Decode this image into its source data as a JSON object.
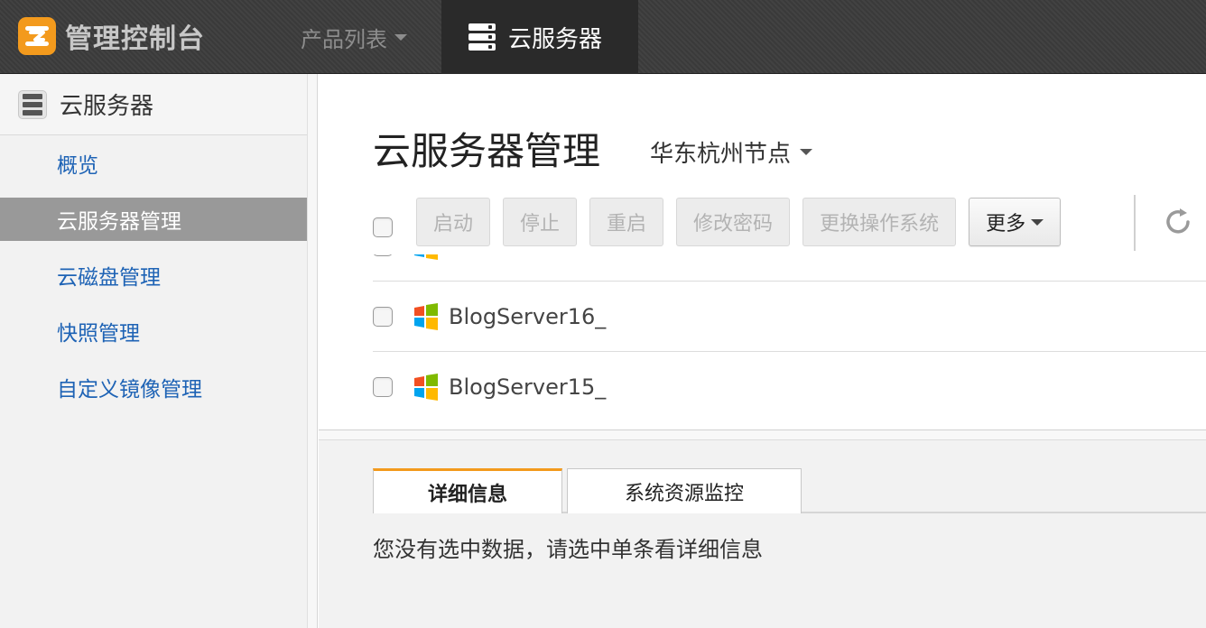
{
  "topbar": {
    "logo_text": "管理控制台",
    "nav_products": "产品列表",
    "nav_active": "云服务器",
    "colors": {
      "brand_orange": "#f39a1d",
      "topbar_bg": "#3a3a3a"
    }
  },
  "sidebar": {
    "header": "云服务器",
    "items": [
      {
        "label": "概览"
      },
      {
        "label": "云服务器管理"
      },
      {
        "label": "云磁盘管理"
      },
      {
        "label": "快照管理"
      },
      {
        "label": "自定义镜像管理"
      }
    ]
  },
  "main": {
    "title": "云服务器管理",
    "region": "华东杭州节点",
    "toolbar": {
      "start": "启动",
      "stop": "停止",
      "restart": "重启",
      "change_password": "修改密码",
      "change_os": "更换操作系统",
      "more": "更多"
    },
    "rows": [
      {
        "name": "BlogServer16_"
      },
      {
        "name": "BlogServer15_"
      }
    ],
    "tabs": {
      "details": "详细信息",
      "monitor": "系统资源监控"
    },
    "empty_message": "您没有选中数据，请选中单条看详细信息"
  }
}
